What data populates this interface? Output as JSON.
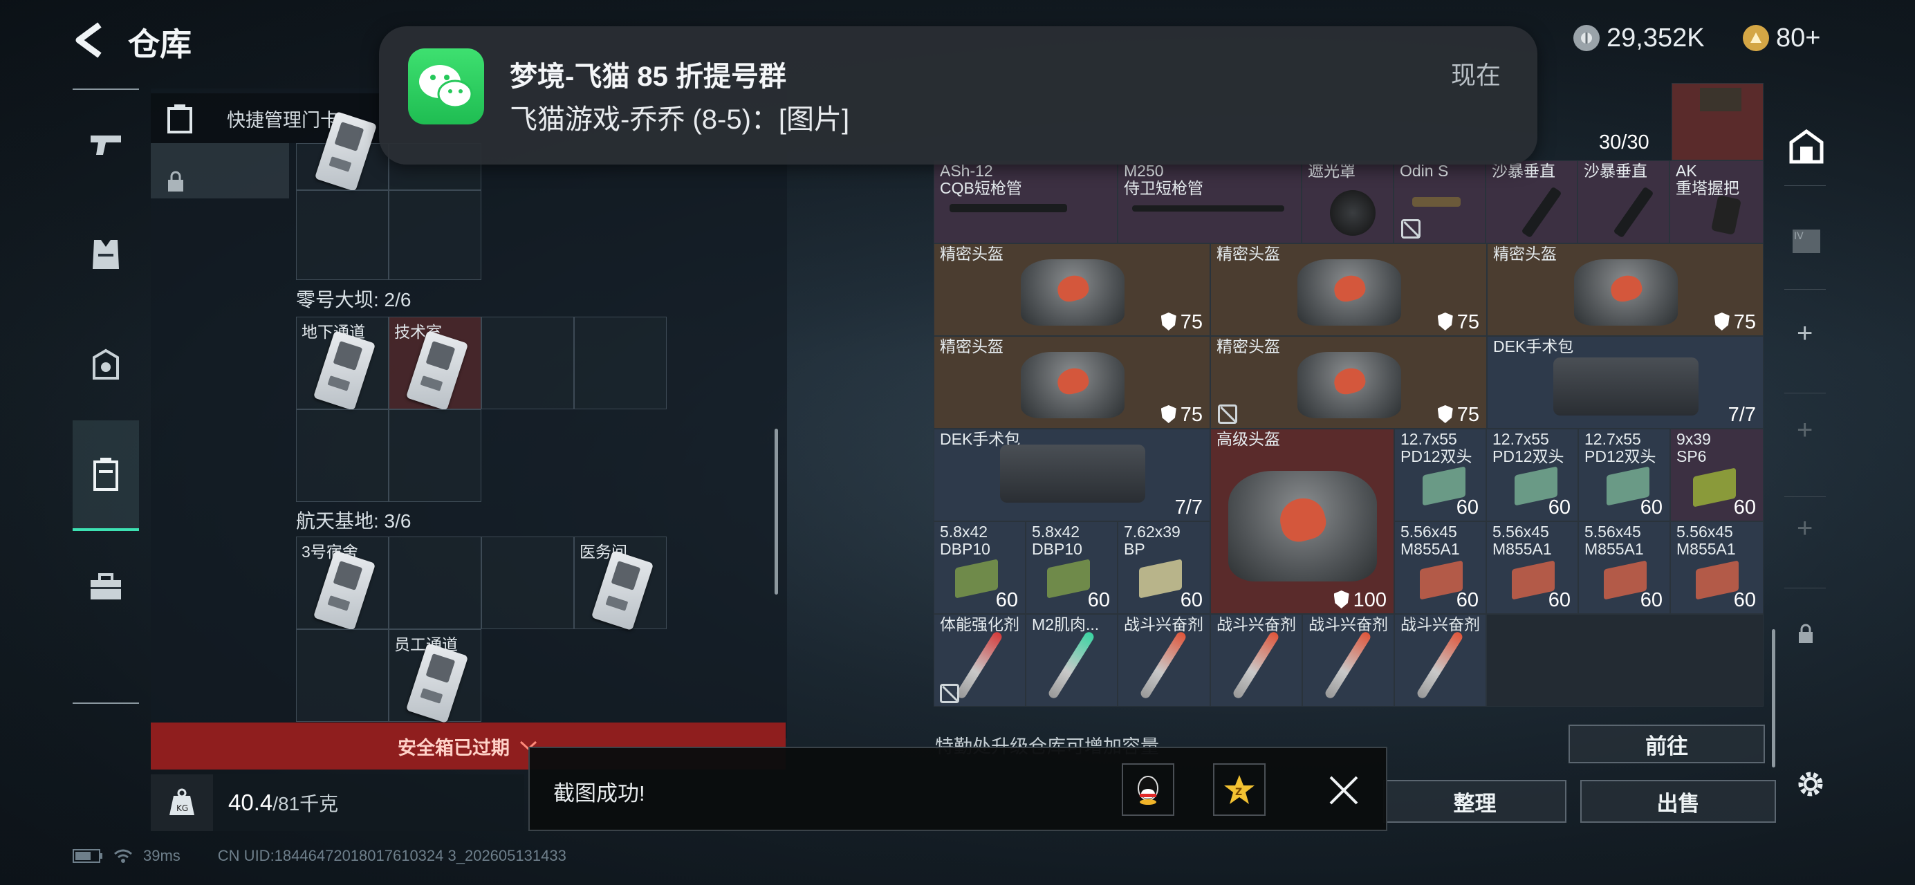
{
  "header": {
    "title": "仓库",
    "currency1": "29,352K",
    "currency2": "80+"
  },
  "notification": {
    "title": "梦境-飞猫 85 折提号群",
    "message": "飞猫游戏-乔乔 (8-5)：[图片]",
    "time": "现在"
  },
  "quick_manage": {
    "label": "快捷管理门卡"
  },
  "maps": [
    {
      "title": "零号大坝: 2/6",
      "cards": [
        {
          "label": "地下通道"
        },
        {
          "label": "技术室"
        }
      ]
    },
    {
      "title": "航天基地: 3/6",
      "cards": [
        {
          "label": "3号宿舍"
        },
        {
          "label": "医务间"
        },
        {
          "label": "员工通道"
        }
      ]
    }
  ],
  "safe_box": {
    "label": "安全箱已过期"
  },
  "weight": {
    "value": "40.4",
    "unit": "/81千克"
  },
  "items": [
    {
      "name": "",
      "count": "30/30"
    },
    {
      "name": "ASh-12\nCQB短枪管"
    },
    {
      "name": "M250\n侍卫短枪管"
    },
    {
      "name": "遮光罩"
    },
    {
      "name": "Odin S"
    },
    {
      "name": "沙暴垂直"
    },
    {
      "name": "沙暴垂直"
    },
    {
      "name": "AK\n重塔握把"
    },
    {
      "name": "精密头盔",
      "count": "75"
    },
    {
      "name": "精密头盔",
      "count": "75"
    },
    {
      "name": "精密头盔",
      "count": "75"
    },
    {
      "name": "精密头盔",
      "count": "75"
    },
    {
      "name": "精密头盔",
      "count": "75"
    },
    {
      "name": "DEK手术包",
      "count": "7/7"
    },
    {
      "name": "DEK手术包",
      "count": "7/7"
    },
    {
      "name": "高级头盔",
      "count": "100"
    },
    {
      "name": "12.7x55\nPD12双头",
      "count": "60"
    },
    {
      "name": "12.7x55\nPD12双头",
      "count": "60"
    },
    {
      "name": "12.7x55\nPD12双头",
      "count": "60"
    },
    {
      "name": "9x39\nSP6",
      "count": "60"
    },
    {
      "name": "5.8x42\nDBP10",
      "count": "60"
    },
    {
      "name": "5.8x42\nDBP10",
      "count": "60"
    },
    {
      "name": "7.62x39\nBP",
      "count": "60"
    },
    {
      "name": "5.56x45\nM855A1",
      "count": "60"
    },
    {
      "name": "5.56x45\nM855A1",
      "count": "60"
    },
    {
      "name": "5.56x45\nM855A1",
      "count": "60"
    },
    {
      "name": "5.56x45\nM855A1",
      "count": "60"
    },
    {
      "name": "体能强化剂"
    },
    {
      "name": "M2肌肉..."
    },
    {
      "name": "战斗兴奋剂"
    },
    {
      "name": "战斗兴奋剂"
    },
    {
      "name": "战斗兴奋剂"
    },
    {
      "name": "战斗兴奋剂"
    }
  ],
  "upgrade_hint": "特勤处升级仓库可增加容量",
  "buttons": {
    "goto": "前往",
    "sort": "整理",
    "sell": "出售"
  },
  "toast": {
    "message": "截图成功!"
  },
  "status": {
    "ping": "39ms",
    "uid": "CN UID:18446472018017610324 3_202605131433"
  },
  "colors": {
    "accent": "#3de2b3",
    "expired": "#8f1e1e",
    "wechat": "#2ccb5d"
  }
}
